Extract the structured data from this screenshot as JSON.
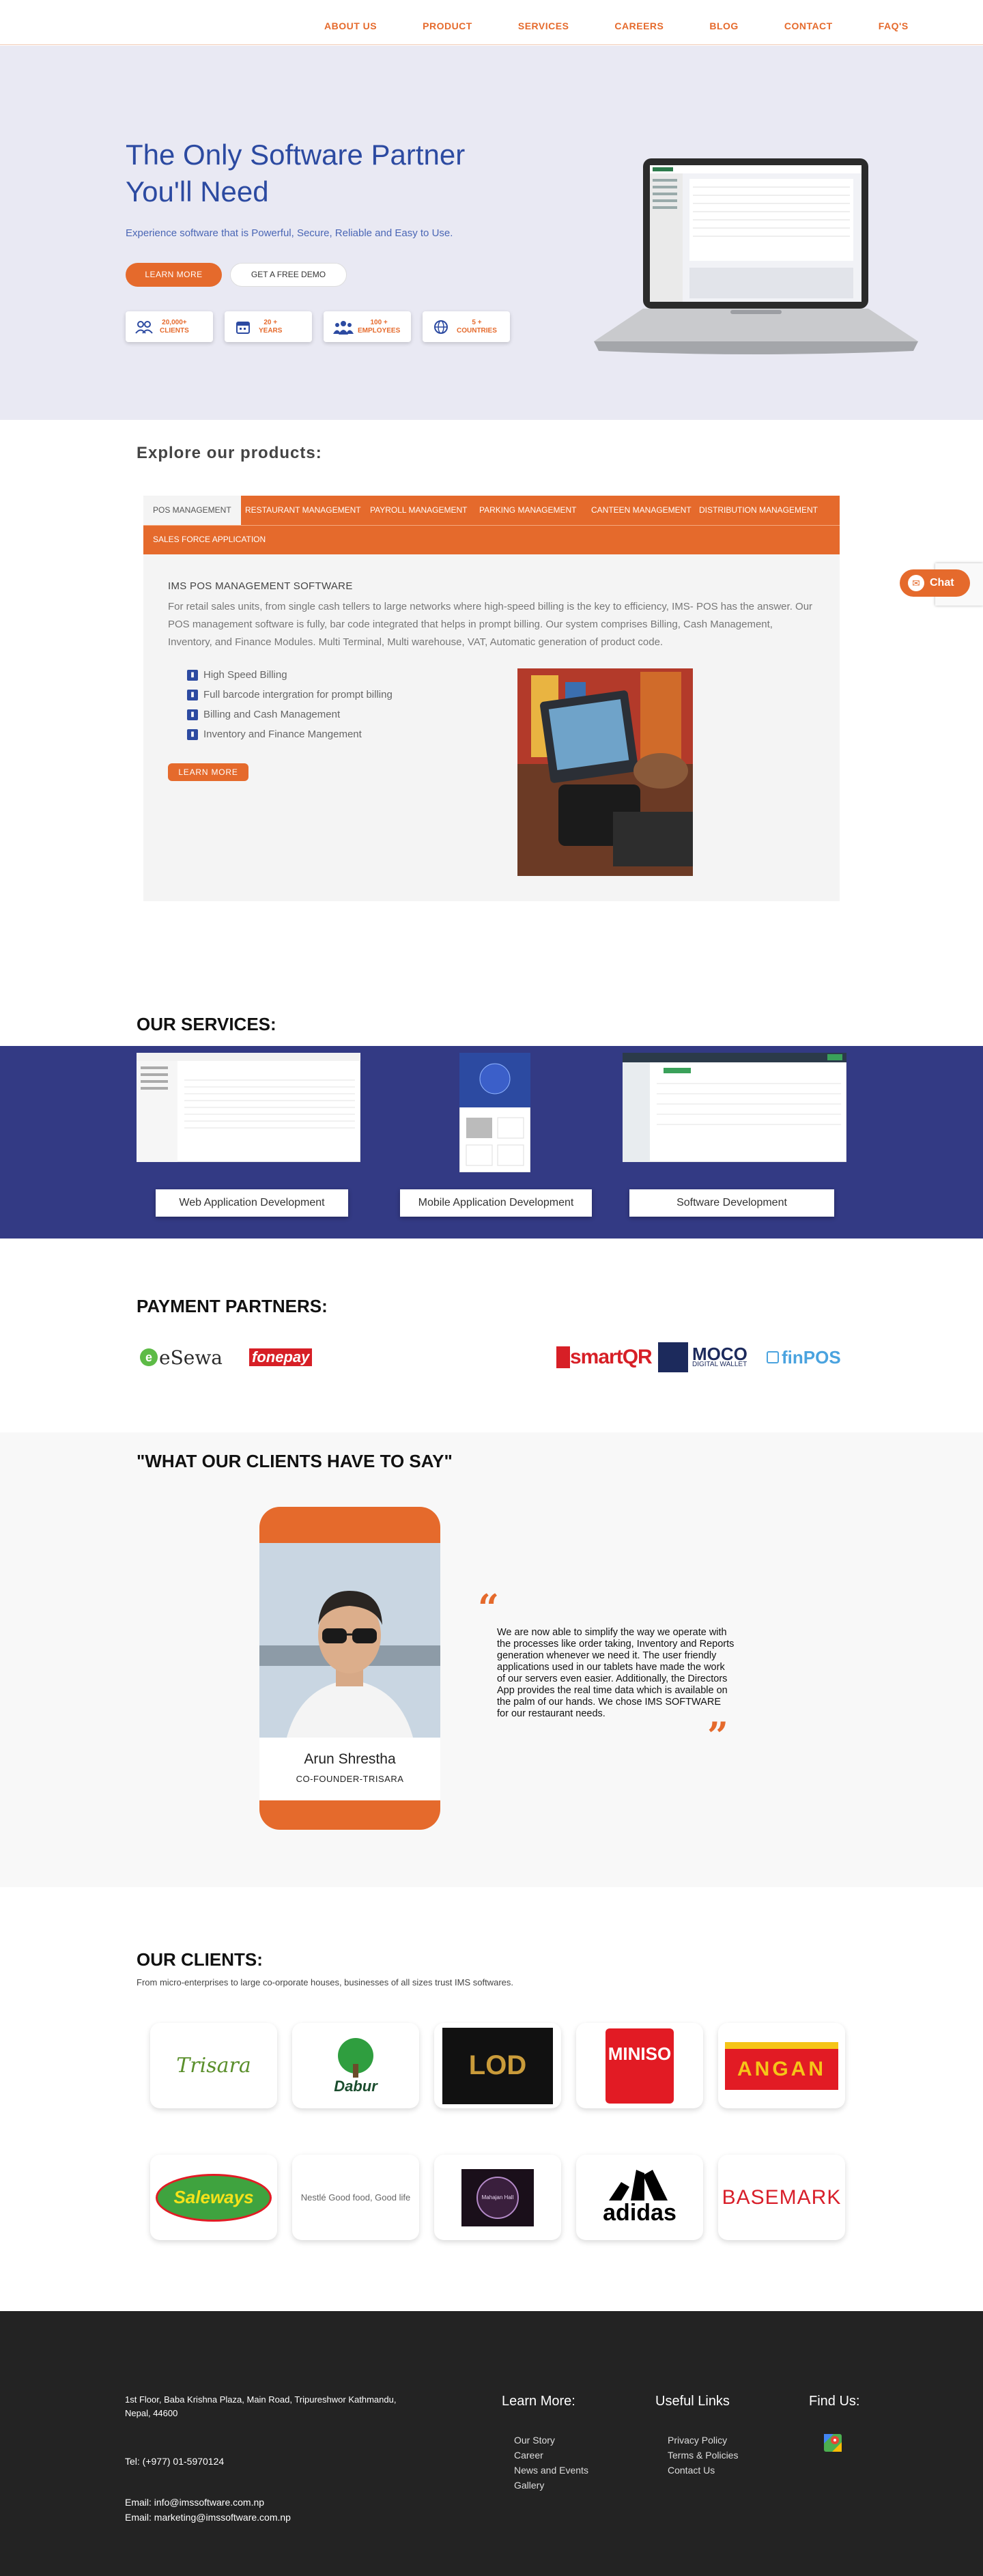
{
  "nav": {
    "items": [
      "ABOUT US",
      "PRODUCT",
      "SERVICES",
      "CAREERS",
      "BLOG",
      "CONTACT",
      "FAQ'S"
    ]
  },
  "hero": {
    "title": "The Only Software Partner You'll Need",
    "subtitle": "Experience software that is Powerful, Secure, Reliable and Easy to Use.",
    "learn_more": "LEARN MORE",
    "free_demo": "GET A FREE DEMO",
    "stats": [
      {
        "value": "20,000+",
        "label": "CLIENTS",
        "icon": "users-icon"
      },
      {
        "value": "20 +",
        "label": "YEARS",
        "icon": "calendar-icon"
      },
      {
        "value": "100 +",
        "label": "EMPLOYEES",
        "icon": "employees-icon"
      },
      {
        "value": "5 +",
        "label": "COUNTRIES",
        "icon": "globe-icon"
      }
    ]
  },
  "products": {
    "title": "Explore our products:",
    "tabs": [
      "POS MANAGEMENT",
      "RESTAURANT MANAGEMENT",
      "PAYROLL MANAGEMENT",
      "PARKING MANAGEMENT",
      "CANTEEN MANAGEMENT",
      "DISTRIBUTION MANAGEMENT",
      "SALES FORCE APPLICATION"
    ],
    "heading": "IMS POS MANAGEMENT SOFTWARE",
    "description": "For retail sales units, from single cash tellers to large networks where high-speed billing is the key to efficiency, IMS- POS has the answer. Our POS management software is fully, bar code integrated that helps in prompt billing. Our system comprises Billing, Cash Management, Inventory, and Finance Modules. Multi Terminal, Multi warehouse, VAT, Automatic generation of product code.",
    "features": [
      "High Speed Billing",
      "Full barcode intergration for prompt billing",
      "Billing and Cash Management",
      "Inventory and Finance Mangement"
    ],
    "learn_more": "LEARN MORE"
  },
  "services": {
    "title": "OUR SERVICES:",
    "items": [
      "Web Application Development",
      "Mobile Application Development",
      "Software Development"
    ]
  },
  "payment": {
    "title": "PAYMENT PARTNERS:",
    "logos": [
      "eSewa",
      "fonepay",
      "smartQR",
      "MOCO",
      "finPOS"
    ],
    "moco_sub": "DIGITAL WALLET"
  },
  "testimonial": {
    "title": "\"WHAT OUR CLIENTS HAVE TO SAY\"",
    "name": "Arun Shrestha",
    "role": "CO-FOUNDER-TRISARA",
    "quote": "We are now able to simplify the way we operate with the processes like order taking, Inventory and Reports generation whenever we need it. The user friendly applications used in our tablets have made the work of our servers even easier. Additionally, the Directors App provides the real time data which is available  on the palm of our hands. We chose IMS SOFTWARE for our restaurant needs."
  },
  "clients": {
    "title": "OUR CLIENTS:",
    "subtitle": "From micro-enterprises to large co-orporate houses, businesses of all sizes trust IMS softwares.",
    "logos": [
      "Trisara",
      "Dabur",
      "LOD",
      "MINISO",
      "ANGAN",
      "Saleways",
      "Nestlé Good food, Good life",
      "Mahajan Hall",
      "adidas",
      "BASEMARK"
    ]
  },
  "footer": {
    "address": "1st Floor, Baba Krishna Plaza, Main Road, Tripureshwor Kathmandu, Nepal, 44600",
    "tel": "Tel: (+977) 01-5970124",
    "email1": "Email: info@imssoftware.com.np",
    "email2": "Email: marketing@imssoftware.com.np",
    "learn_more_head": "Learn More:",
    "learn_links": [
      "Our Story",
      "Career",
      "News and Events",
      "Gallery"
    ],
    "useful_head": "Useful Links",
    "useful_links": [
      "Privacy Policy",
      "Terms & Policies",
      "Contact Us"
    ],
    "find_head": "Find Us:"
  },
  "chat": {
    "label": "Chat"
  },
  "colors": {
    "accent": "#e56a2c",
    "brand_blue": "#2c4aa1",
    "services_band": "#333a84",
    "footer_bg": "#232323"
  }
}
